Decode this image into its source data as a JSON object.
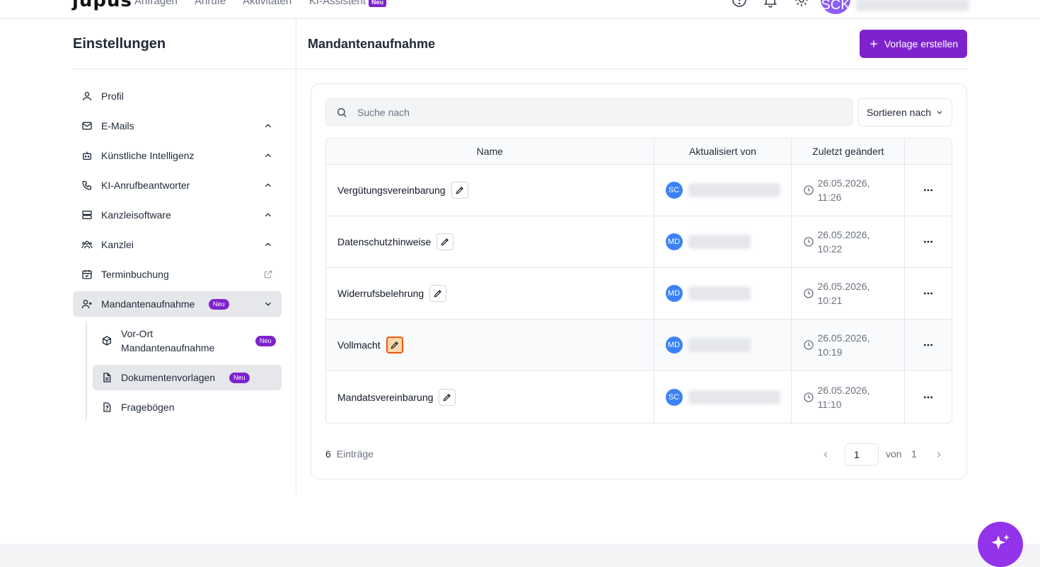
{
  "topnav": {
    "logo": "jupus",
    "links": [
      "Anfragen",
      "Anrufe",
      "Aktivitäten",
      "KI-Assistent"
    ],
    "ki_badge": "Neu",
    "user_initials": "SCK"
  },
  "settings": {
    "title": "Einstellungen",
    "menu": [
      {
        "label": "Profil"
      },
      {
        "label": "E-Mails"
      },
      {
        "label": "Künstliche Intelligenz"
      },
      {
        "label": "KI-Anrufbeantworter"
      },
      {
        "label": "Kanzleisoftware"
      },
      {
        "label": "Kanzlei"
      },
      {
        "label": "Terminbuchung"
      },
      {
        "label": "Mandantenaufnahme",
        "badge": "Neu"
      }
    ],
    "submenu": [
      {
        "label": "Vor-Ort Mandantenaufnahme",
        "badge": "Neu"
      },
      {
        "label": "Dokumentenvorlagen",
        "badge": "Neu"
      },
      {
        "label": "Fragebögen"
      }
    ]
  },
  "main": {
    "title": "Mandantenaufnahme",
    "create_button": "Vorlage erstellen",
    "search_placeholder": "Suche nach",
    "sort_label": "Sortieren nach",
    "columns": [
      "Name",
      "Aktualisiert von",
      "Zuletzt geändert"
    ],
    "rows": [
      {
        "name": "Vergütungsvereinbarung",
        "initials": "SC",
        "date": "26.05.2026, 11:26"
      },
      {
        "name": "Datenschutzhinweise",
        "initials": "MD",
        "date": "26.05.2026, 10:22"
      },
      {
        "name": "Widerrufsbelehrung",
        "initials": "MD",
        "date": "26.05.2026, 10:21"
      },
      {
        "name": "Vollmacht",
        "initials": "MD",
        "date": "26.05.2026, 10:19"
      },
      {
        "name": "Mandatsvereinbarung",
        "initials": "SC",
        "date": "26.05.2026, 11:10"
      }
    ],
    "entries_count": "6",
    "entries_label": "Einträge",
    "page_current": "1",
    "page_of": "von",
    "page_total": "1"
  },
  "colors": {
    "primary": "#7e22ce",
    "avatar_blue": "#3b82f6",
    "focus_orange": "#ea580c"
  }
}
